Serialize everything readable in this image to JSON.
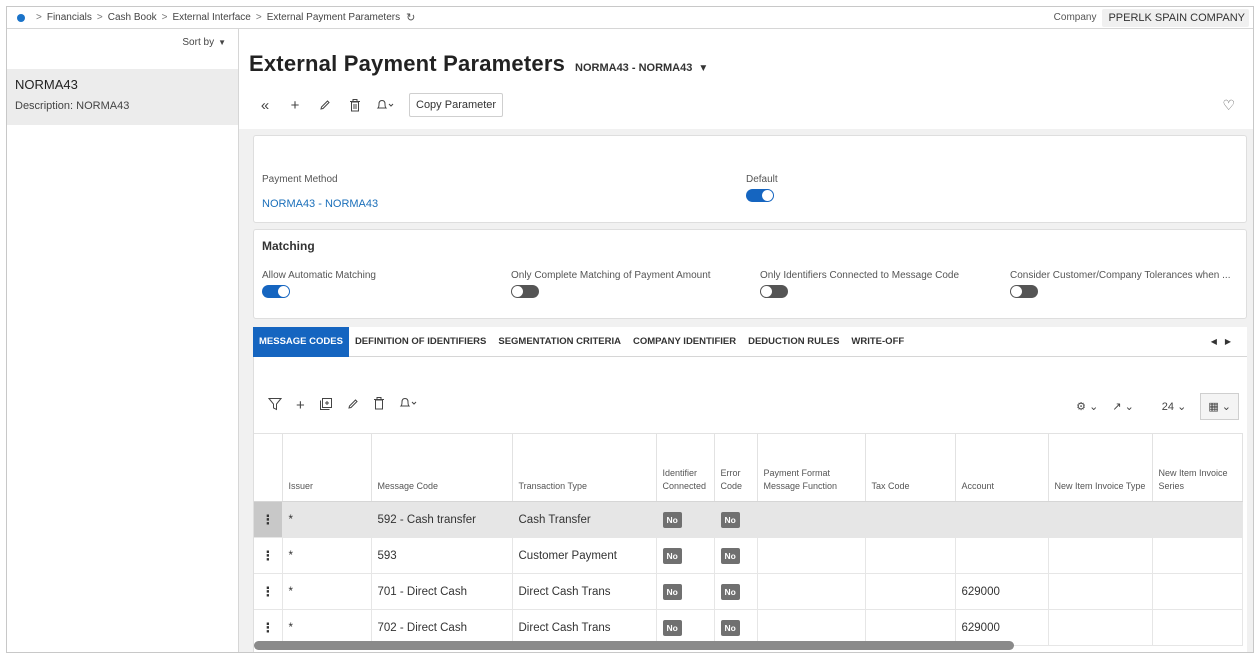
{
  "breadcrumb": [
    "Financials",
    "Cash Book",
    "External Interface",
    "External Payment Parameters"
  ],
  "company": {
    "label": "Company",
    "value": "PPERLK SPAIN COMPANY"
  },
  "left_panel": {
    "sort_label": "Sort by",
    "record": {
      "title": "NORMA43",
      "description_label": "Description:",
      "description_value": "NORMA43"
    }
  },
  "header": {
    "title": "External Payment Parameters",
    "subtitle": "NORMA43 - NORMA43",
    "copy_button": "Copy Parameter"
  },
  "general": {
    "payment_method_label": "Payment Method",
    "payment_method_value": "NORMA43 - NORMA43",
    "default_label": "Default",
    "default_on": true
  },
  "matching": {
    "heading": "Matching",
    "fields": [
      {
        "label": "Allow Automatic Matching",
        "on": true
      },
      {
        "label": "Only Complete Matching of Payment Amount",
        "on": false
      },
      {
        "label": "Only Identifiers Connected to Message Code",
        "on": false
      },
      {
        "label": "Consider Customer/Company Tolerances when ...",
        "on": false
      }
    ]
  },
  "tabs": [
    "MESSAGE CODES",
    "DEFINITION OF IDENTIFIERS",
    "SEGMENTATION CRITERIA",
    "COMPANY IDENTIFIER",
    "DEDUCTION RULES",
    "WRITE-OFF"
  ],
  "grid": {
    "page_size": "24",
    "columns": [
      "Issuer",
      "Message Code",
      "Transaction Type",
      "Identifier Connected",
      "Error Code",
      "Payment Format Message Function",
      "Tax Code",
      "Account",
      "New Item Invoice Type",
      "New Item Invoice Series"
    ],
    "rows": [
      {
        "issuer": "*",
        "message_code": "592 - Cash transfer",
        "transaction_type": "Cash Transfer",
        "identifier_connected": "No",
        "error_code": "No",
        "pf_message_function": "",
        "tax_code": "",
        "account": "",
        "inv_type": "",
        "inv_series": ""
      },
      {
        "issuer": "*",
        "message_code": "593",
        "transaction_type": "Customer Payment",
        "identifier_connected": "No",
        "error_code": "No",
        "pf_message_function": "",
        "tax_code": "",
        "account": "",
        "inv_type": "",
        "inv_series": ""
      },
      {
        "issuer": "*",
        "message_code": "701 - Direct Cash",
        "transaction_type": "Direct Cash Trans",
        "identifier_connected": "No",
        "error_code": "No",
        "pf_message_function": "",
        "tax_code": "",
        "account": "629000",
        "inv_type": "",
        "inv_series": ""
      },
      {
        "issuer": "*",
        "message_code": "702 - Direct Cash",
        "transaction_type": "Direct Cash Trans",
        "identifier_connected": "No",
        "error_code": "No",
        "pf_message_function": "",
        "tax_code": "",
        "account": "629000",
        "inv_type": "",
        "inv_series": ""
      }
    ]
  }
}
